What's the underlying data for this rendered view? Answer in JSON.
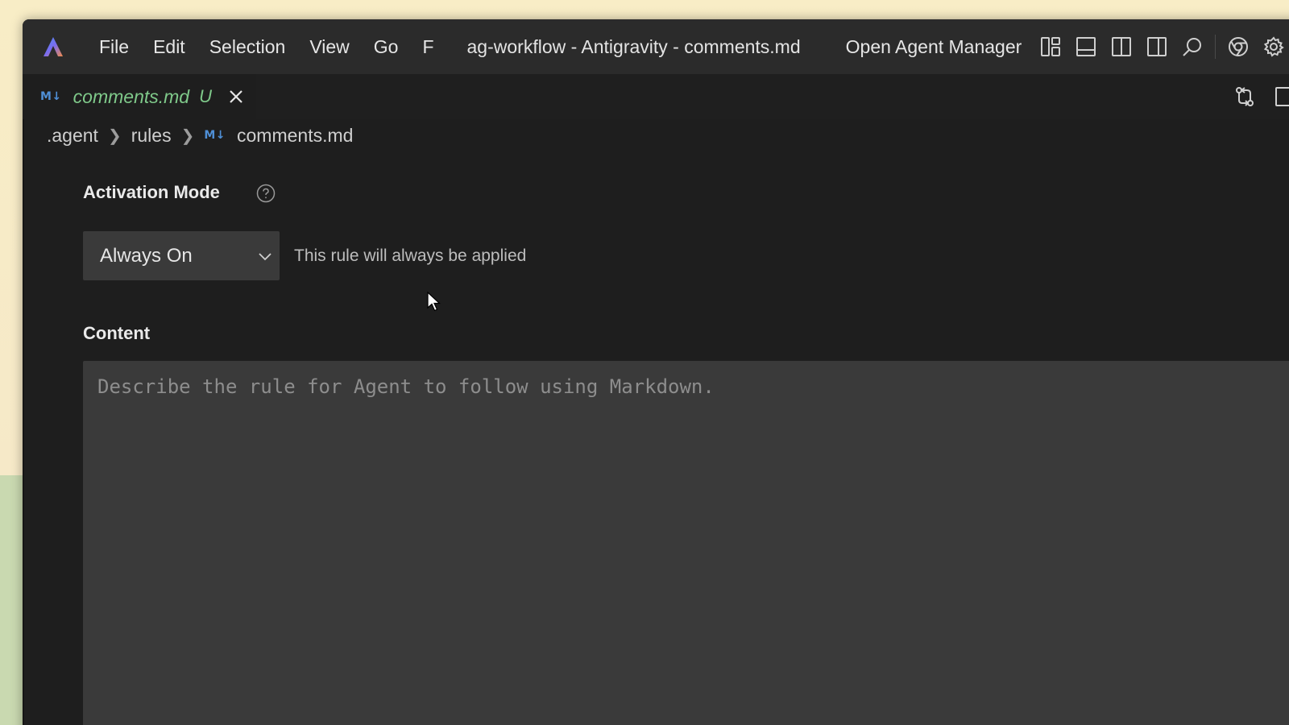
{
  "menu": {
    "items": [
      "File",
      "Edit",
      "Selection",
      "View",
      "Go",
      "F"
    ]
  },
  "window": {
    "title": "ag-workflow - Antigravity - comments.md",
    "agent_manager_label": "Open Agent Manager"
  },
  "title_icons": [
    "layout-icon",
    "panel-bottom-icon",
    "split-editor-icon",
    "sidebar-right-icon",
    "search-icon",
    "chrome-icon",
    "gear-icon"
  ],
  "tab": {
    "badge": "M↓",
    "name": "comments.md",
    "status": "U"
  },
  "breadcrumb": {
    "items": [
      ".agent",
      "rules"
    ],
    "file_badge": "M↓",
    "file": "comments.md"
  },
  "form": {
    "activation_label": "Activation Mode",
    "mode_value": "Always On",
    "mode_description": "This rule will always be applied",
    "content_label": "Content",
    "content_placeholder": "Describe the rule for Agent to follow using Markdown."
  },
  "colors": {
    "accent_md": "#4f8fd6",
    "tab_untracked": "#7fc98a",
    "editor_bg": "#1e1e1e",
    "field_bg": "#3a3a3a"
  }
}
